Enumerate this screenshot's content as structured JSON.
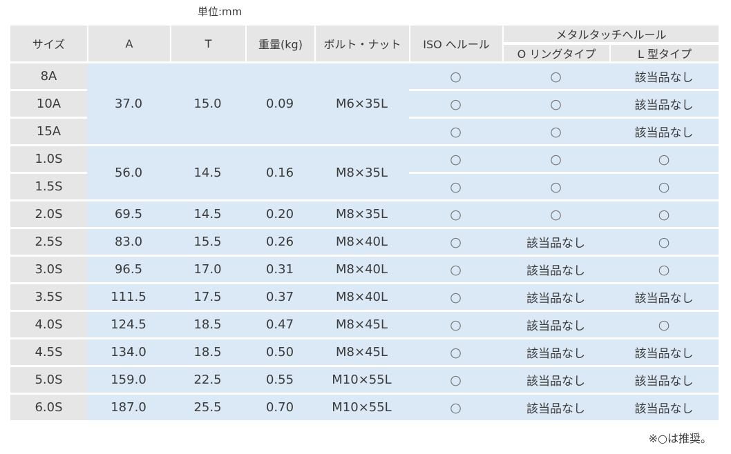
{
  "unit_label": "単位:mm",
  "headers": {
    "size": "サイズ",
    "a": "A",
    "t": "T",
    "weight": "重量(kg)",
    "bolt": "ボルト・ナット",
    "iso": "ISO へルール",
    "metal_group": "メタルタッチへルール",
    "o_ring": "O リングタイプ",
    "l_type": "L 型タイプ"
  },
  "groups": [
    {
      "a": "37.0",
      "t": "15.0",
      "weight": "0.09",
      "bolt": "M6×35L",
      "rows": [
        {
          "size": "8A",
          "iso": "○",
          "o_ring": "○",
          "l_type": "該当品なし"
        },
        {
          "size": "10A",
          "iso": "○",
          "o_ring": "○",
          "l_type": "該当品なし"
        },
        {
          "size": "15A",
          "iso": "○",
          "o_ring": "○",
          "l_type": "該当品なし"
        }
      ]
    },
    {
      "a": "56.0",
      "t": "14.5",
      "weight": "0.16",
      "bolt": "M8×35L",
      "rows": [
        {
          "size": "1.0S",
          "iso": "○",
          "o_ring": "○",
          "l_type": "○"
        },
        {
          "size": "1.5S",
          "iso": "○",
          "o_ring": "○",
          "l_type": "○"
        }
      ]
    },
    {
      "a": "69.5",
      "t": "14.5",
      "weight": "0.20",
      "bolt": "M8×35L",
      "rows": [
        {
          "size": "2.0S",
          "iso": "○",
          "o_ring": "○",
          "l_type": "○"
        }
      ]
    },
    {
      "a": "83.0",
      "t": "15.5",
      "weight": "0.26",
      "bolt": "M8×40L",
      "rows": [
        {
          "size": "2.5S",
          "iso": "○",
          "o_ring": "該当品なし",
          "l_type": "○"
        }
      ]
    },
    {
      "a": "96.5",
      "t": "17.0",
      "weight": "0.31",
      "bolt": "M8×40L",
      "rows": [
        {
          "size": "3.0S",
          "iso": "○",
          "o_ring": "該当品なし",
          "l_type": "○"
        }
      ]
    },
    {
      "a": "111.5",
      "t": "17.5",
      "weight": "0.37",
      "bolt": "M8×40L",
      "rows": [
        {
          "size": "3.5S",
          "iso": "○",
          "o_ring": "該当品なし",
          "l_type": "該当品なし"
        }
      ]
    },
    {
      "a": "124.5",
      "t": "18.5",
      "weight": "0.47",
      "bolt": "M8×45L",
      "rows": [
        {
          "size": "4.0S",
          "iso": "○",
          "o_ring": "該当品なし",
          "l_type": "○"
        }
      ]
    },
    {
      "a": "134.0",
      "t": "18.5",
      "weight": "0.50",
      "bolt": "M8×45L",
      "rows": [
        {
          "size": "4.5S",
          "iso": "○",
          "o_ring": "該当品なし",
          "l_type": "該当品なし"
        }
      ]
    },
    {
      "a": "159.0",
      "t": "22.5",
      "weight": "0.55",
      "bolt": "M10×55L",
      "rows": [
        {
          "size": "5.0S",
          "iso": "○",
          "o_ring": "該当品なし",
          "l_type": "該当品なし"
        }
      ]
    },
    {
      "a": "187.0",
      "t": "25.5",
      "weight": "0.70",
      "bolt": "M10×55L",
      "rows": [
        {
          "size": "6.0S",
          "iso": "○",
          "o_ring": "該当品なし",
          "l_type": "該当品なし"
        }
      ]
    }
  ],
  "note": "※○は推奨。"
}
